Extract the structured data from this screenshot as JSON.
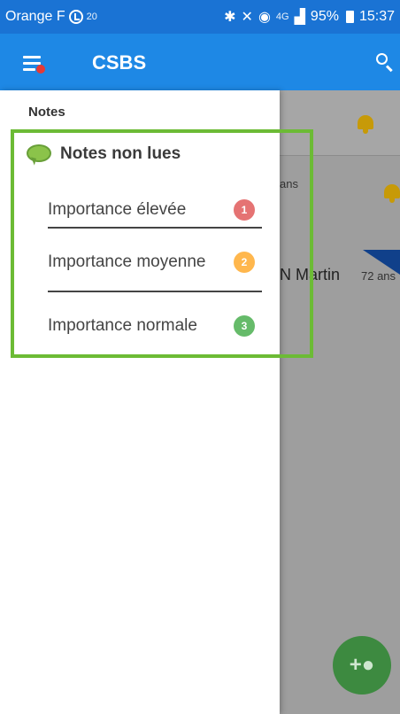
{
  "status_bar": {
    "carrier": "Orange F",
    "small_indicator": "20",
    "network": "4G",
    "battery": "95%",
    "time": "15:37"
  },
  "app_bar": {
    "title": "CSBS"
  },
  "background": {
    "text_ans": "ans",
    "name": "N Martin",
    "age": "72 ans",
    "fab_icon": "add-person-icon"
  },
  "drawer": {
    "section_title": "Notes",
    "group_label": "Notes non lues",
    "items": [
      {
        "label": "Importance élevée",
        "count": "1",
        "color": "#e57373"
      },
      {
        "label": "Importance moyenne",
        "count": "2",
        "color": "#ffb74d"
      },
      {
        "label": "Importance normale",
        "count": "3",
        "color": "#66bb6a"
      }
    ]
  },
  "colors": {
    "status_bar": "#1a73d4",
    "app_bar": "#1e88e5",
    "highlight": "#6cbb35",
    "fab": "#3d8a40"
  }
}
